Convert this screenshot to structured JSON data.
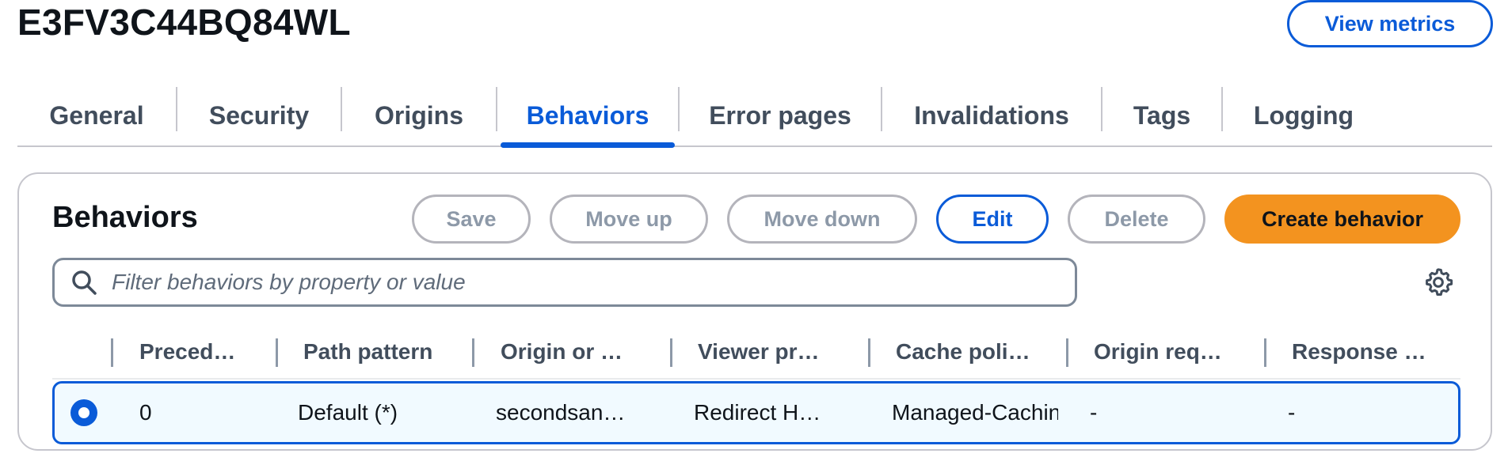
{
  "header": {
    "distribution_id": "E3FV3C44BQ84WL",
    "view_metrics_label": "View metrics"
  },
  "tabs": [
    {
      "label": "General"
    },
    {
      "label": "Security"
    },
    {
      "label": "Origins"
    },
    {
      "label": "Behaviors",
      "active": true
    },
    {
      "label": "Error pages"
    },
    {
      "label": "Invalidations"
    },
    {
      "label": "Tags"
    },
    {
      "label": "Logging"
    }
  ],
  "behaviors": {
    "title": "Behaviors",
    "buttons": {
      "save": "Save",
      "move_up": "Move up",
      "move_down": "Move down",
      "edit": "Edit",
      "delete": "Delete",
      "create": "Create behavior"
    },
    "search": {
      "placeholder": "Filter behaviors by property or value",
      "value": ""
    },
    "columns": [
      "Preced…",
      "Path pattern",
      "Origin or …",
      "Viewer pr…",
      "Cache poli…",
      "Origin req…",
      "Response …"
    ],
    "rows": [
      {
        "selected": true,
        "cells": [
          "0",
          "Default (*)",
          "secondsan…",
          "Redirect H…",
          "Managed-Cachin",
          "-",
          "-"
        ]
      }
    ]
  },
  "colors": {
    "accent": "#0a5bd8",
    "primary_button": "#f3931f",
    "selected_row_bg": "#f1faff"
  },
  "icons": {
    "search": "magnifier-icon",
    "settings": "gear-icon"
  }
}
